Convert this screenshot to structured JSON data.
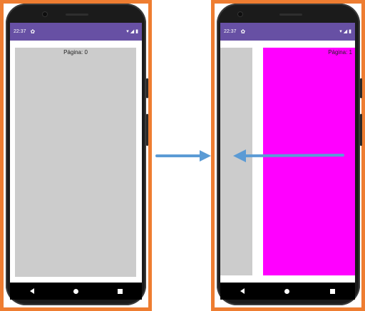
{
  "colors": {
    "frame": "#ee7d31",
    "status_bar": "#6750a4",
    "page_0": "#cccccc",
    "page_1": "#ff00ff",
    "arrow": "#5b9bd5"
  },
  "left_phone": {
    "status": {
      "time": "22:37",
      "settings_icon": "gear-icon",
      "signal_icons": [
        "wifi-icon",
        "signal-icon",
        "battery-icon"
      ]
    },
    "page": {
      "label": "Página: 0"
    },
    "nav": [
      "back-icon",
      "home-icon",
      "recents-icon"
    ]
  },
  "right_phone": {
    "status": {
      "time": "22:37",
      "settings_icon": "gear-icon",
      "signal_icons": [
        "wifi-icon",
        "signal-icon",
        "battery-icon"
      ]
    },
    "page": {
      "label": "Página: 1"
    },
    "nav": [
      "back-icon",
      "home-icon",
      "recents-icon"
    ]
  },
  "transition_arrow": "arrow-right",
  "swipe_arrow": "arrow-left"
}
